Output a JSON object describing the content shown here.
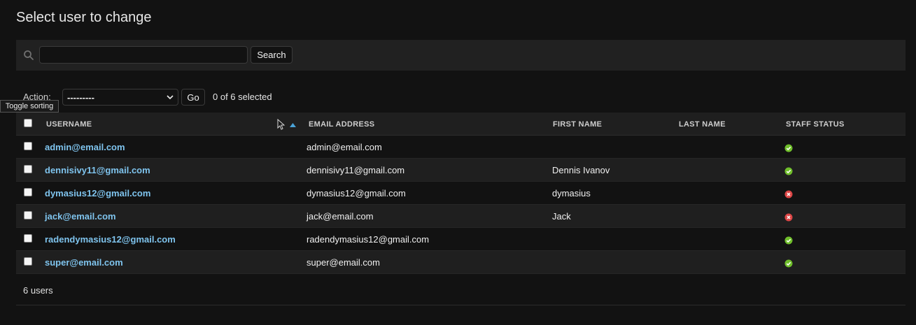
{
  "page": {
    "title": "Select user to change"
  },
  "search": {
    "placeholder": "",
    "value": "",
    "button_label": "Search"
  },
  "actions": {
    "label": "Action:",
    "selected_option": "---------",
    "go_label": "Go",
    "selected_count": "0 of 6 selected"
  },
  "tooltip": {
    "text": "Toggle sorting"
  },
  "table": {
    "columns": [
      "USERNAME",
      "EMAIL ADDRESS",
      "FIRST NAME",
      "LAST NAME",
      "STAFF STATUS"
    ],
    "rows": [
      {
        "username": "admin@email.com",
        "email": "admin@email.com",
        "first_name": "",
        "last_name": "",
        "staff": true
      },
      {
        "username": "dennisivy11@gmail.com",
        "email": "dennisivy11@gmail.com",
        "first_name": "Dennis Ivanov",
        "last_name": "",
        "staff": true
      },
      {
        "username": "dymasius12@gmail.com",
        "email": "dymasius12@gmail.com",
        "first_name": "dymasius",
        "last_name": "",
        "staff": false
      },
      {
        "username": "jack@email.com",
        "email": "jack@email.com",
        "first_name": "Jack",
        "last_name": "",
        "staff": false
      },
      {
        "username": "radendymasius12@gmail.com",
        "email": "radendymasius12@gmail.com",
        "first_name": "",
        "last_name": "",
        "staff": true
      },
      {
        "username": "super@email.com",
        "email": "super@email.com",
        "first_name": "",
        "last_name": "",
        "staff": true
      }
    ]
  },
  "footer": {
    "count": "6 users"
  },
  "icons": {
    "staff_true": "check-circle-icon",
    "staff_false": "x-circle-icon",
    "search": "search-icon",
    "sort": "sort-ascending-icon"
  },
  "colors": {
    "link": "#7fc4ee",
    "yes": "#70bf2b",
    "no": "#dd4646"
  }
}
